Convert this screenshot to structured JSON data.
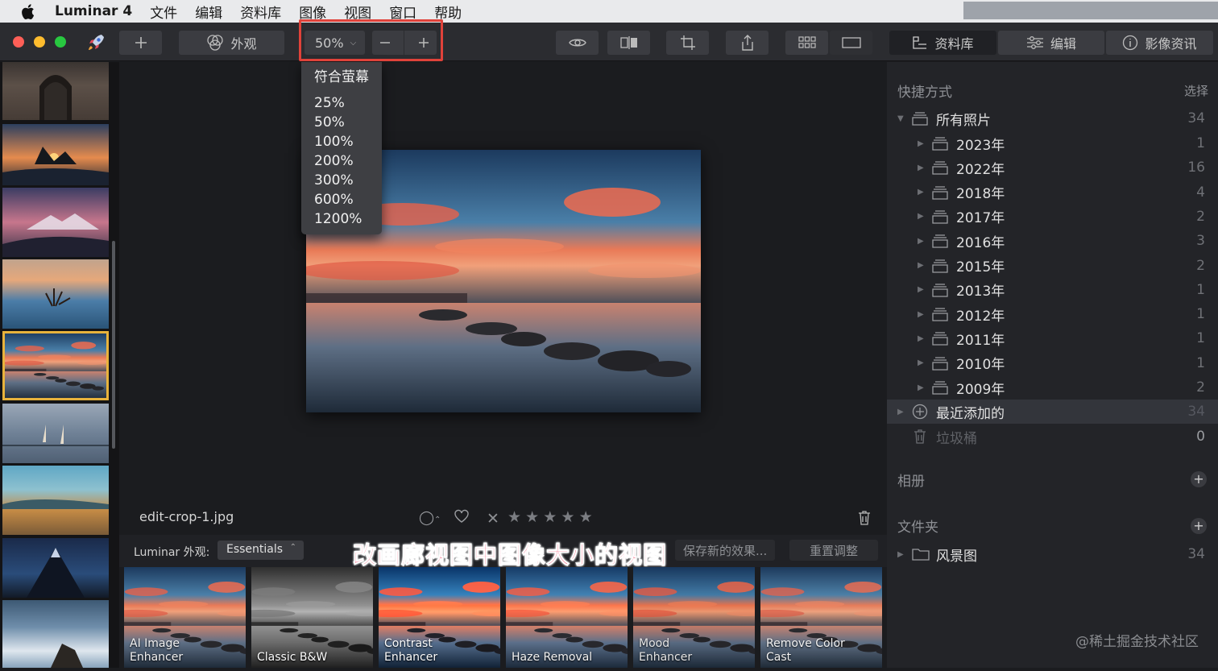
{
  "menubar": {
    "app_name": "Luminar 4",
    "items": [
      "文件",
      "编辑",
      "资料库",
      "图像",
      "视图",
      "窗口",
      "帮助"
    ]
  },
  "toolbar": {
    "looks_label": "外观",
    "zoom_value": "50%",
    "tabs": {
      "library": "资料库",
      "edit": "编辑",
      "info": "影像资讯"
    }
  },
  "zoom_menu": {
    "fit": "符合萤幕",
    "options": [
      "25%",
      "50%",
      "100%",
      "200%",
      "300%",
      "600%",
      "1200%"
    ]
  },
  "viewer": {
    "filename": "edit-crop-1.jpg"
  },
  "presets_bar": {
    "label": "Luminar 外观:",
    "collection": "Essentials",
    "save_label": "保存新的效果...",
    "reset_label": "重置调整"
  },
  "presets": [
    {
      "label": "AI Image\nEnhancer"
    },
    {
      "label": "Classic B&W"
    },
    {
      "label": "Contrast\nEnhancer"
    },
    {
      "label": "Haze Removal"
    },
    {
      "label": "Mood\nEnhancer"
    },
    {
      "label": "Remove Color\nCast"
    }
  ],
  "sidebar": {
    "shortcuts_title": "快捷方式",
    "select_label": "选择",
    "all_photos": {
      "label": "所有照片",
      "count": "34"
    },
    "years": [
      {
        "label": "2023年",
        "count": "1"
      },
      {
        "label": "2022年",
        "count": "16"
      },
      {
        "label": "2018年",
        "count": "4"
      },
      {
        "label": "2017年",
        "count": "2"
      },
      {
        "label": "2016年",
        "count": "3"
      },
      {
        "label": "2015年",
        "count": "2"
      },
      {
        "label": "2013年",
        "count": "1"
      },
      {
        "label": "2012年",
        "count": "1"
      },
      {
        "label": "2011年",
        "count": "1"
      },
      {
        "label": "2010年",
        "count": "1"
      },
      {
        "label": "2009年",
        "count": "2"
      }
    ],
    "recently_added": {
      "label": "最近添加的",
      "count": "34"
    },
    "trash": {
      "label": "垃圾桶",
      "count": "0"
    },
    "albums_title": "相册",
    "folders_title": "文件夹",
    "folder": {
      "label": "风景图",
      "count": "34"
    }
  },
  "caption": "改画廊视图中图像大小的视图",
  "watermark": "@稀土掘金技术社区",
  "colors": {
    "highlight_red": "#e0423a",
    "selected_thumb": "#e8b33c",
    "caption_pink": "#f4476a"
  }
}
